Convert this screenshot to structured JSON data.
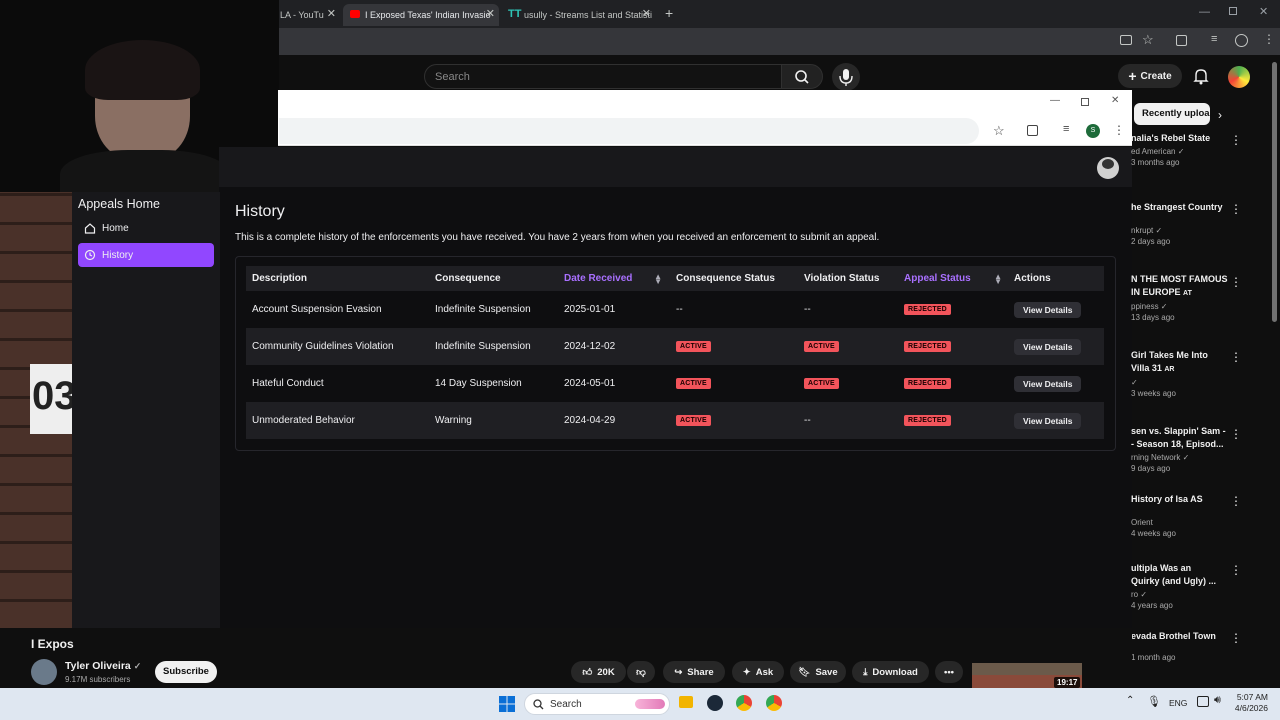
{
  "browser": {
    "tabs": [
      {
        "title": "LA - YouTu"
      },
      {
        "title": "I Exposed Texas' Indian Invasio"
      },
      {
        "title": "usully - Streams List and Statisti"
      }
    ]
  },
  "youtube": {
    "search_placeholder": "Search",
    "create_label": "Create",
    "channel_name": "Tyler Oliveira",
    "subscribers": "9.17M subscribers",
    "subscribe_label": "Subscribe",
    "video_title_partial": "I Expos",
    "actions": {
      "likes": "20K",
      "share": "Share",
      "ask": "Ask",
      "save": "Save",
      "download": "Download"
    },
    "thumb_duration": "19:17",
    "recs_chip": "Recently uploa",
    "recommendations": [
      {
        "title": "nalia's Rebel State",
        "channel": "ed American",
        "meta": "3 months ago"
      },
      {
        "title": "he Strangest Country",
        "channel": "nkrupt",
        "meta": "2 days ago"
      },
      {
        "title": "N THE MOST FAMOUS\nIN EUROPE",
        "suffix": "AT",
        "channel": "ppiness",
        "meta": "13 days ago"
      },
      {
        "title": "Girl Takes Me Into\nVilla 31",
        "suffix": "AR",
        "channel": "",
        "meta": "3 weeks ago"
      },
      {
        "title": "sen vs. Slappin' Sam -\n- Season 18, Episod...",
        "channel": "rning Network",
        "meta": "9 days ago"
      },
      {
        "title": "History of Isa AS",
        "channel": "Orient",
        "meta": "4 weeks ago"
      },
      {
        "title": "ultipla Was an\nQuirky (and Ugly) ...",
        "channel": "ro",
        "meta": "4 years ago"
      },
      {
        "title": "evada Brothel Town",
        "channel": "",
        "meta": "1 month ago"
      }
    ]
  },
  "app": {
    "sidebar": {
      "title": "Appeals Home",
      "items": [
        {
          "label": "Home"
        },
        {
          "label": "History"
        }
      ]
    },
    "page_title": "History",
    "description": "This is a complete history of the enforcements you have received. You have 2 years from when you received an enforcement to submit an appeal.",
    "table": {
      "headers": [
        "Description",
        "Consequence",
        "Date Received",
        "Consequence Status",
        "Violation Status",
        "Appeal Status",
        "Actions"
      ],
      "rows": [
        {
          "description": "Account Suspension Evasion",
          "consequence": "Indefinite Suspension",
          "date": "2025-01-01",
          "consequence_status": "--",
          "violation_status": "--",
          "appeal_status": "REJECTED",
          "action": "View Details"
        },
        {
          "description": "Community Guidelines Violation",
          "consequence": "Indefinite Suspension",
          "date": "2024-12-02",
          "consequence_status": "ACTIVE",
          "violation_status": "ACTIVE",
          "appeal_status": "REJECTED",
          "action": "View Details"
        },
        {
          "description": "Hateful Conduct",
          "consequence": "14 Day Suspension",
          "date": "2024-05-01",
          "consequence_status": "ACTIVE",
          "violation_status": "ACTIVE",
          "appeal_status": "REJECTED",
          "action": "View Details"
        },
        {
          "description": "Unmoderated Behavior",
          "consequence": "Warning",
          "date": "2024-04-29",
          "consequence_status": "ACTIVE",
          "violation_status": "--",
          "appeal_status": "REJECTED",
          "action": "View Details"
        }
      ]
    }
  },
  "taskbar": {
    "search_label": "Search",
    "language": "ENG",
    "time": "5:07 AM",
    "date": "4/6/2026"
  },
  "colors": {
    "accent": "#9147ff",
    "sort_header": "#a970ff",
    "pill": "#f2545b",
    "background": "#0e0e10"
  }
}
